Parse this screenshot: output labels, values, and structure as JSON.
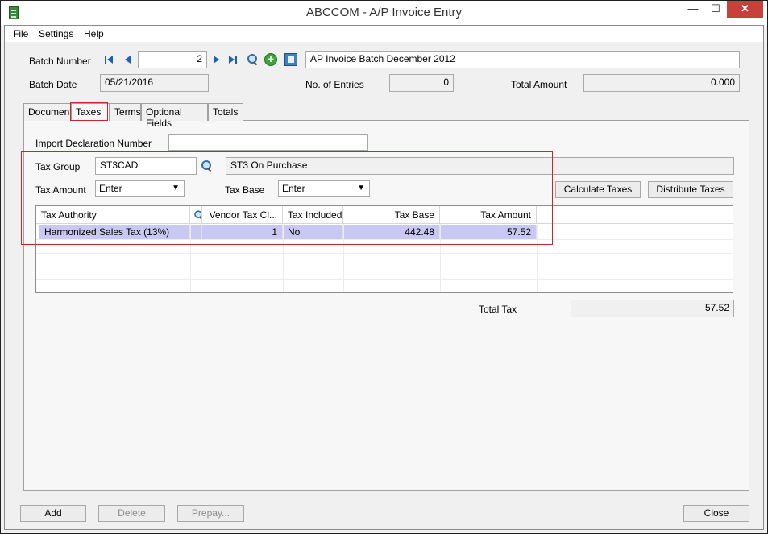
{
  "window": {
    "title": "ABCCOM - A/P Invoice Entry",
    "min_glyph": "—",
    "max_glyph": "☐",
    "close_glyph": "✕"
  },
  "menu": [
    "File",
    "Settings",
    "Help"
  ],
  "header": {
    "batch_number_label": "Batch Number",
    "batch_number_value": "2",
    "batch_description": "AP Invoice Batch December 2012",
    "batch_date_label": "Batch Date",
    "batch_date_value": "05/21/2016",
    "entries_label": "No. of Entries",
    "entries_value": "0",
    "total_amount_label": "Total Amount",
    "total_amount_value": "0.000"
  },
  "tabs": [
    "Document",
    "Taxes",
    "Terms",
    "Optional Fields",
    "Totals"
  ],
  "active_tab": "Taxes",
  "taxes": {
    "import_decl_label": "Import Declaration Number",
    "import_decl_value": "",
    "tax_group_label": "Tax Group",
    "tax_group_value": "ST3CAD",
    "tax_group_desc": "ST3 On Purchase",
    "tax_amount_label": "Tax Amount",
    "tax_amount_value": "Enter",
    "tax_base_label": "Tax Base",
    "tax_base_value": "Enter",
    "calculate_label": "Calculate Taxes",
    "distribute_label": "Distribute Taxes",
    "grid": {
      "columns": [
        "Tax Authority",
        "",
        "Vendor Tax Cl...",
        "Tax Included",
        "Tax Base",
        "Tax Amount"
      ],
      "rows": [
        [
          "Harmonized Sales Tax (13%)",
          "",
          "1",
          "No",
          "442.48",
          "57.52"
        ]
      ]
    },
    "total_tax_label": "Total Tax",
    "total_tax_value": "57.52"
  },
  "footer": {
    "add_label": "Add",
    "delete_label": "Delete",
    "prepay_label": "Prepay...",
    "close_label": "Close"
  },
  "colors": {
    "highlight_box": "#c8262c",
    "selected_row": "#c8c8f2",
    "close_button": "#c7403a"
  }
}
